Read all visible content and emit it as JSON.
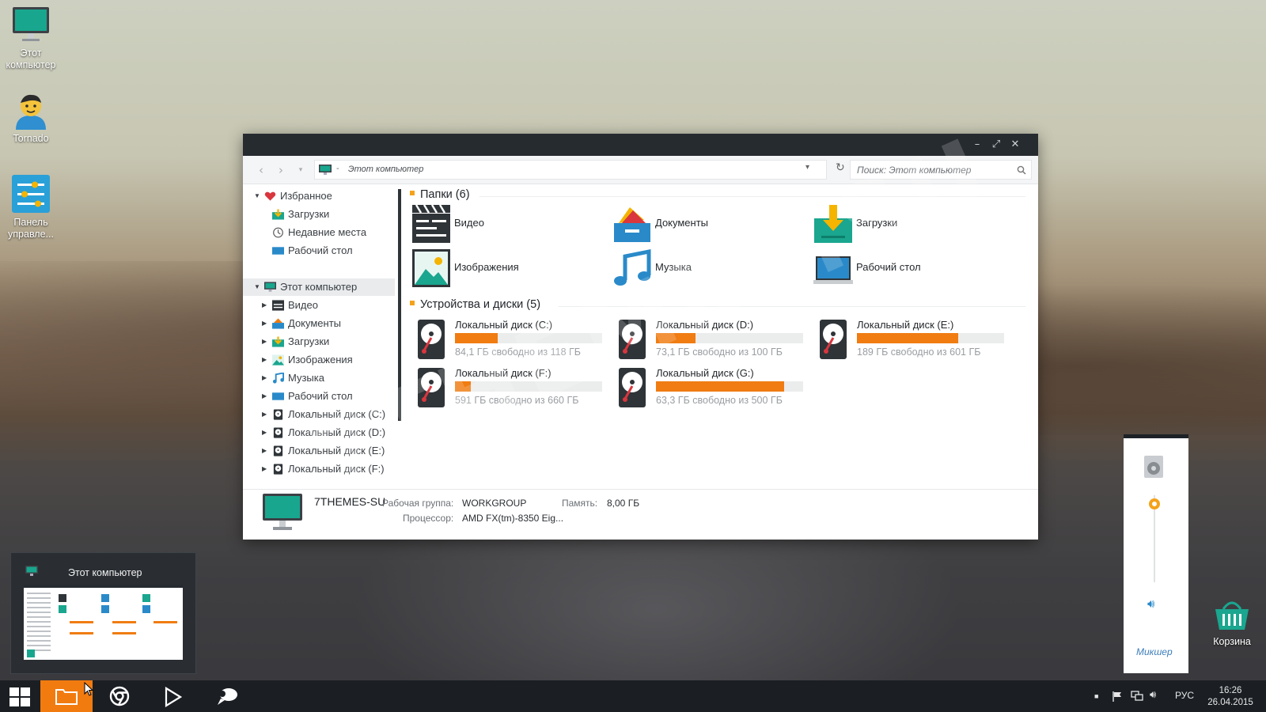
{
  "desktop": {
    "icons": [
      {
        "label": "Этот компьютер"
      },
      {
        "label": "Tornado"
      },
      {
        "label": "Панель управле..."
      },
      {
        "label": "Корзина"
      }
    ]
  },
  "window": {
    "address_path": "Этот компьютер",
    "address_sep": "-",
    "search_placeholder": "Поиск: Этот компьютер",
    "sidebar": {
      "favorites": {
        "label": "Избранное",
        "items": [
          "Загрузки",
          "Недавние места",
          "Рабочий стол"
        ]
      },
      "computer": {
        "label": "Этот компьютер",
        "items": [
          "Видео",
          "Документы",
          "Загрузки",
          "Изображения",
          "Музыка",
          "Рабочий стол",
          "Локальный диск (C:)",
          "Локальный диск (D:)",
          "Локальный диск (E:)",
          "Локальный диск (F:)"
        ]
      }
    },
    "folders_header": "Папки (6)",
    "folders": [
      {
        "label": "Видео",
        "icon": "video-icon"
      },
      {
        "label": "Документы",
        "icon": "documents-icon"
      },
      {
        "label": "Загрузки",
        "icon": "downloads-icon"
      },
      {
        "label": "Изображения",
        "icon": "images-icon"
      },
      {
        "label": "Музыка",
        "icon": "music-icon"
      },
      {
        "label": "Рабочий стол",
        "icon": "desktop-icon"
      }
    ],
    "drives_header": "Устройства и диски (5)",
    "drives": [
      {
        "name": "Локальный диск (C:)",
        "free": "84,1 ГБ свободно из 118 ГБ",
        "used_fraction": 0.29
      },
      {
        "name": "Локальный диск (D:)",
        "free": "73,1 ГБ свободно из 100 ГБ",
        "used_fraction": 0.27
      },
      {
        "name": "Локальный диск (E:)",
        "free": "189 ГБ свободно из 601 ГБ",
        "used_fraction": 0.69
      },
      {
        "name": "Локальный диск (F:)",
        "free": "591 ГБ свободно из 660 ГБ",
        "used_fraction": 0.11
      },
      {
        "name": "Локальный диск (G:)",
        "free": "63,3 ГБ свободно из 500 ГБ",
        "used_fraction": 0.87
      }
    ],
    "details": {
      "pc_name": "7THEMES-SU",
      "workgroup_label": "Рабочая группа:",
      "workgroup": "WORKGROUP",
      "memory_label": "Память:",
      "memory": "8,00 ГБ",
      "cpu_label": "Процессор:",
      "cpu": "AMD FX(tm)-8350 Eig..."
    }
  },
  "thumbnail": {
    "title": "Этот компьютер"
  },
  "volume": {
    "mixer_label": "Микшер",
    "level_fraction": 0.9
  },
  "tray": {
    "lang": "РУС",
    "time": "16:26",
    "date": "26.04.2015"
  },
  "colors": {
    "accent": "#f27b10",
    "bar_fill": "#f07c12",
    "taskbar": "#1b1f24",
    "titlebar": "#262b30",
    "teal": "#1aa68f"
  }
}
